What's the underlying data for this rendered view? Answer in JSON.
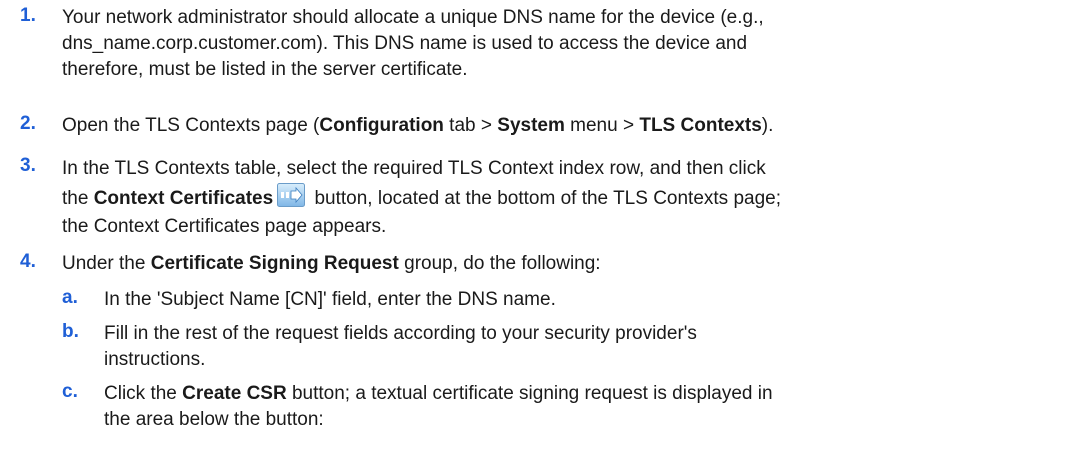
{
  "steps": [
    {
      "num": "1.",
      "lines": [
        "Your network administrator should allocate a unique DNS name for the device (e.g.,",
        "dns_name.corp.customer.com). This DNS name is used to access the device and",
        "therefore, must be listed in the server certificate."
      ]
    },
    {
      "num": "2.",
      "t1": "Open the TLS Contexts page (",
      "b1": "Configuration",
      "t2": " tab > ",
      "b2": "System",
      "t3": " menu > ",
      "b3": "TLS Contexts",
      "t4": ")."
    },
    {
      "num": "3.",
      "line1": "In the TLS Contexts table, select the required TLS Context index row, and then click",
      "l2_t1": "the ",
      "l2_b1": "Context Certificates",
      "l2_t2": " button, located at the bottom of the TLS Contexts page;",
      "line3": "the Context Certificates page appears.",
      "icon": "arrow-button-icon"
    },
    {
      "num": "4.",
      "t1": "Under the ",
      "b1": "Certificate Signing Request",
      "t2": " group, do the following:"
    }
  ],
  "substeps": [
    {
      "num": "a.",
      "line1": "In the 'Subject Name [CN]' field, enter the DNS name."
    },
    {
      "num": "b.",
      "line1": "Fill in the rest of the request fields according to your security provider's",
      "line2": "instructions."
    },
    {
      "num": "c.",
      "l1_t1": "Click the ",
      "l1_b1": "Create CSR",
      "l1_t2": " button; a textual certificate signing request is displayed in",
      "line2": "the area below the button:"
    }
  ],
  "colors": {
    "number": "#1f5fd6",
    "text": "#1a1a1a"
  }
}
